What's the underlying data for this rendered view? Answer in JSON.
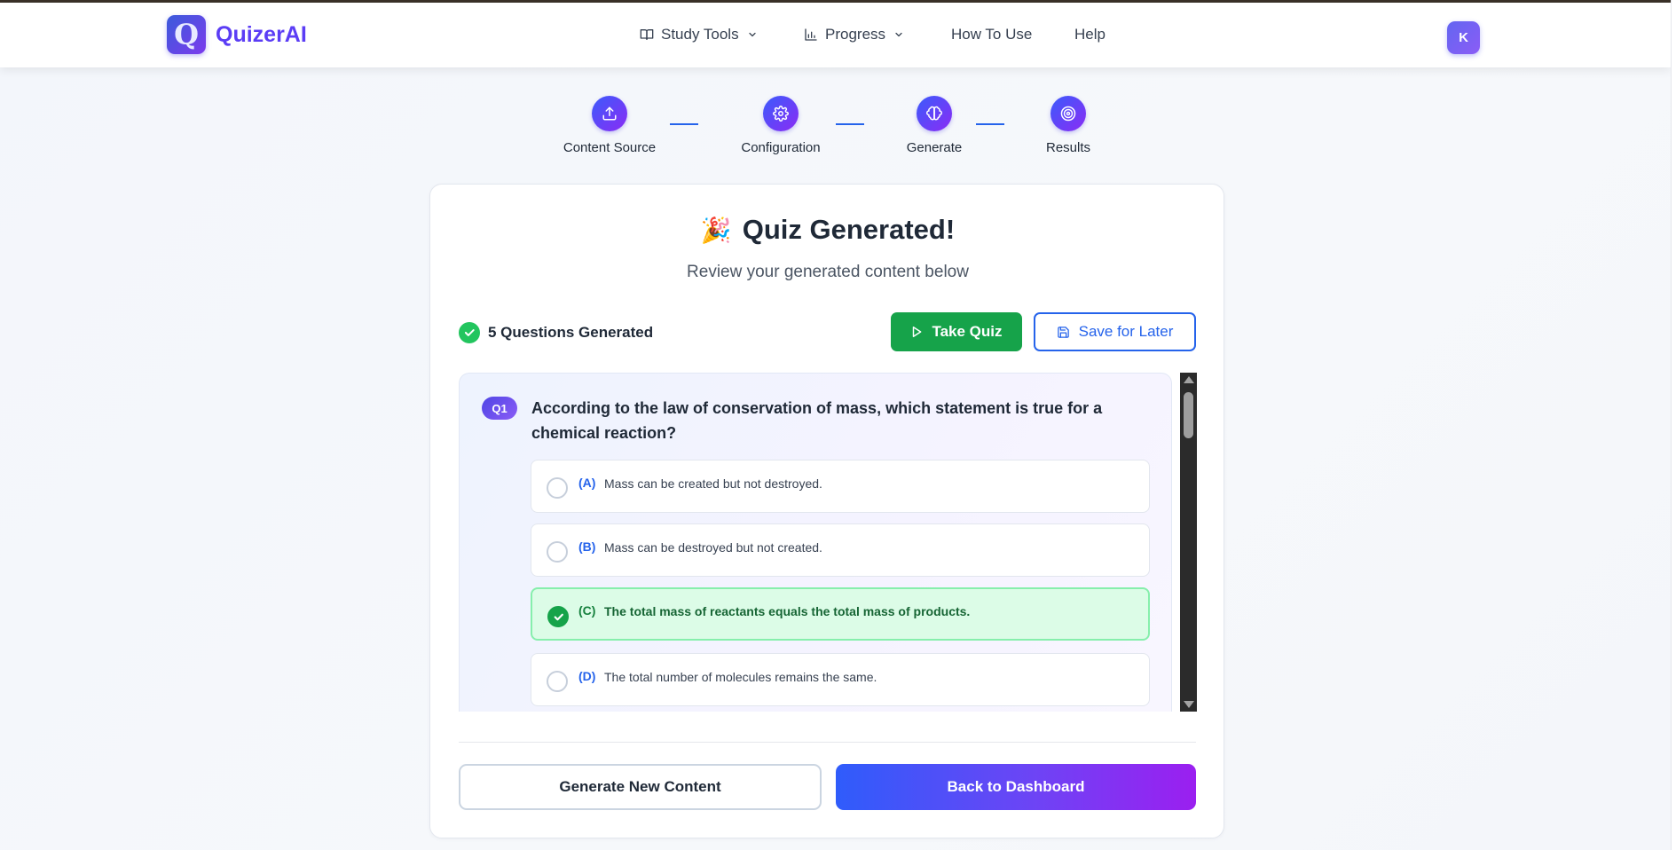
{
  "app": {
    "brand": "QuizerAI",
    "logo_letter": "Q",
    "accent": "#5b3df5"
  },
  "nav": {
    "study_tools": "Study Tools",
    "progress": "Progress",
    "how_to_use": "How To Use",
    "help": "Help",
    "avatar_initial": "K"
  },
  "steps": [
    {
      "label": "Content Source",
      "icon": "upload-icon"
    },
    {
      "label": "Configuration",
      "icon": "gear-icon"
    },
    {
      "label": "Generate",
      "icon": "brain-icon"
    },
    {
      "label": "Results",
      "icon": "target-icon"
    }
  ],
  "result": {
    "emoji": "🎉",
    "title": "Quiz Generated!",
    "subtitle": "Review your generated content below",
    "count_label": "5 Questions Generated",
    "take_quiz": "Take Quiz",
    "save_later": "Save for Later"
  },
  "question": {
    "badge": "Q1",
    "text": "According to the law of conservation of mass, which statement is true for a chemical reaction?",
    "options": [
      {
        "letter": "(A)",
        "text": "Mass can be created but not destroyed.",
        "correct": false
      },
      {
        "letter": "(B)",
        "text": "Mass can be destroyed but not created.",
        "correct": false
      },
      {
        "letter": "(C)",
        "text": "The total mass of reactants equals the total mass of products.",
        "correct": true
      },
      {
        "letter": "(D)",
        "text": "The total number of molecules remains the same.",
        "correct": false
      }
    ]
  },
  "footer": {
    "generate_new": "Generate New Content",
    "back_dashboard": "Back to Dashboard"
  },
  "colors": {
    "success": "#16a34a",
    "primary": "#2563eb",
    "gradient_start": "#2f5cfb",
    "gradient_end": "#9b1ff0"
  }
}
